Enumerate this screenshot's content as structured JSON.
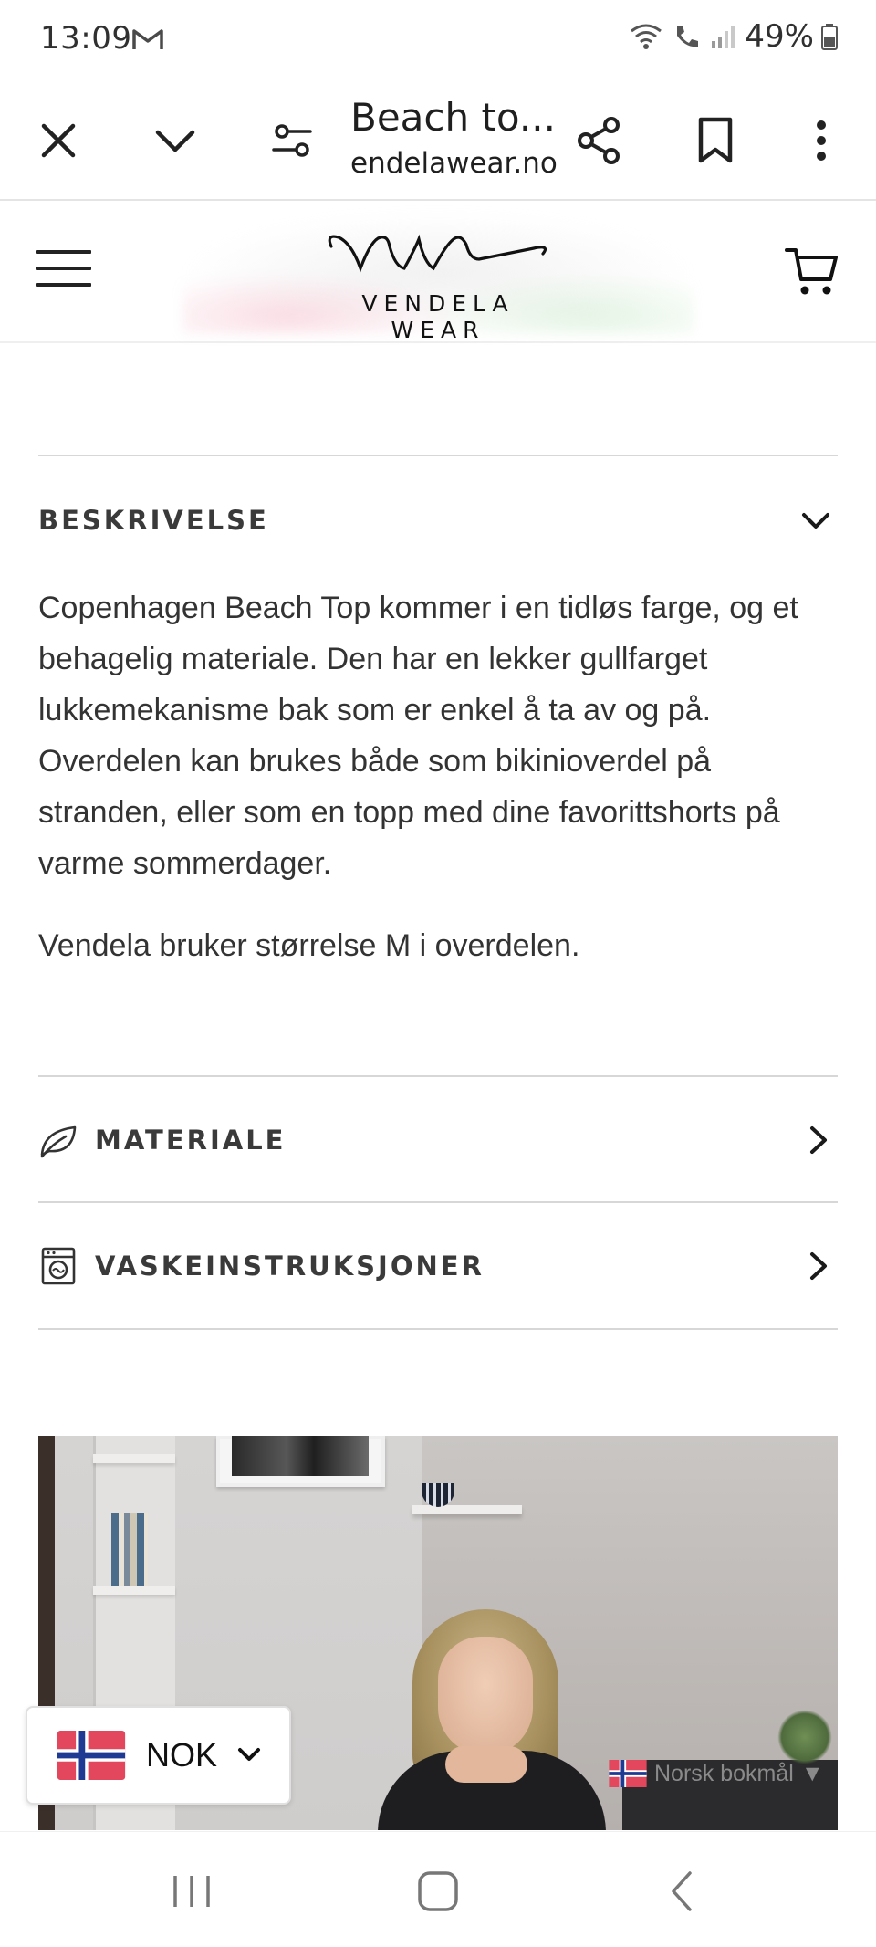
{
  "status_bar": {
    "time": "13:09",
    "battery": "49%"
  },
  "browser": {
    "title": "Beach to...",
    "url": "endelawear.no",
    "icons": [
      "close-icon",
      "chevron-down-icon",
      "page-settings-icon",
      "share-icon",
      "bookmark-icon",
      "more-vert-icon"
    ]
  },
  "site": {
    "brand": "VENDELA WEAR",
    "monogram": "vw"
  },
  "description": {
    "heading": "BESKRIVELSE",
    "paragraph_1": "Copenhagen Beach Top kommer i en tidløs farge, og et behagelig materiale. Den har en lekker gullfarget lukkemekanisme bak som er enkel å ta av og på. Overdelen kan brukes både som bikinioverdel på stranden, eller som en topp med dine favorittshorts på varme sommerdager.",
    "paragraph_2": "Vendela bruker størrelse M i overdelen."
  },
  "accordion": [
    {
      "label": "MATERIALE",
      "icon": "leaf-icon"
    },
    {
      "label": "VASKEINSTRUKSJONER",
      "icon": "washing-machine-icon"
    }
  ],
  "language_selector": {
    "label": "Norsk bokmål",
    "arrow": "▼"
  },
  "currency_selector": {
    "label": "NOK"
  },
  "colors": {
    "accent_text": "#3a3a3a",
    "divider": "#d7d7d7",
    "flag_red": "#e2475e",
    "flag_blue": "#1f3a93"
  }
}
